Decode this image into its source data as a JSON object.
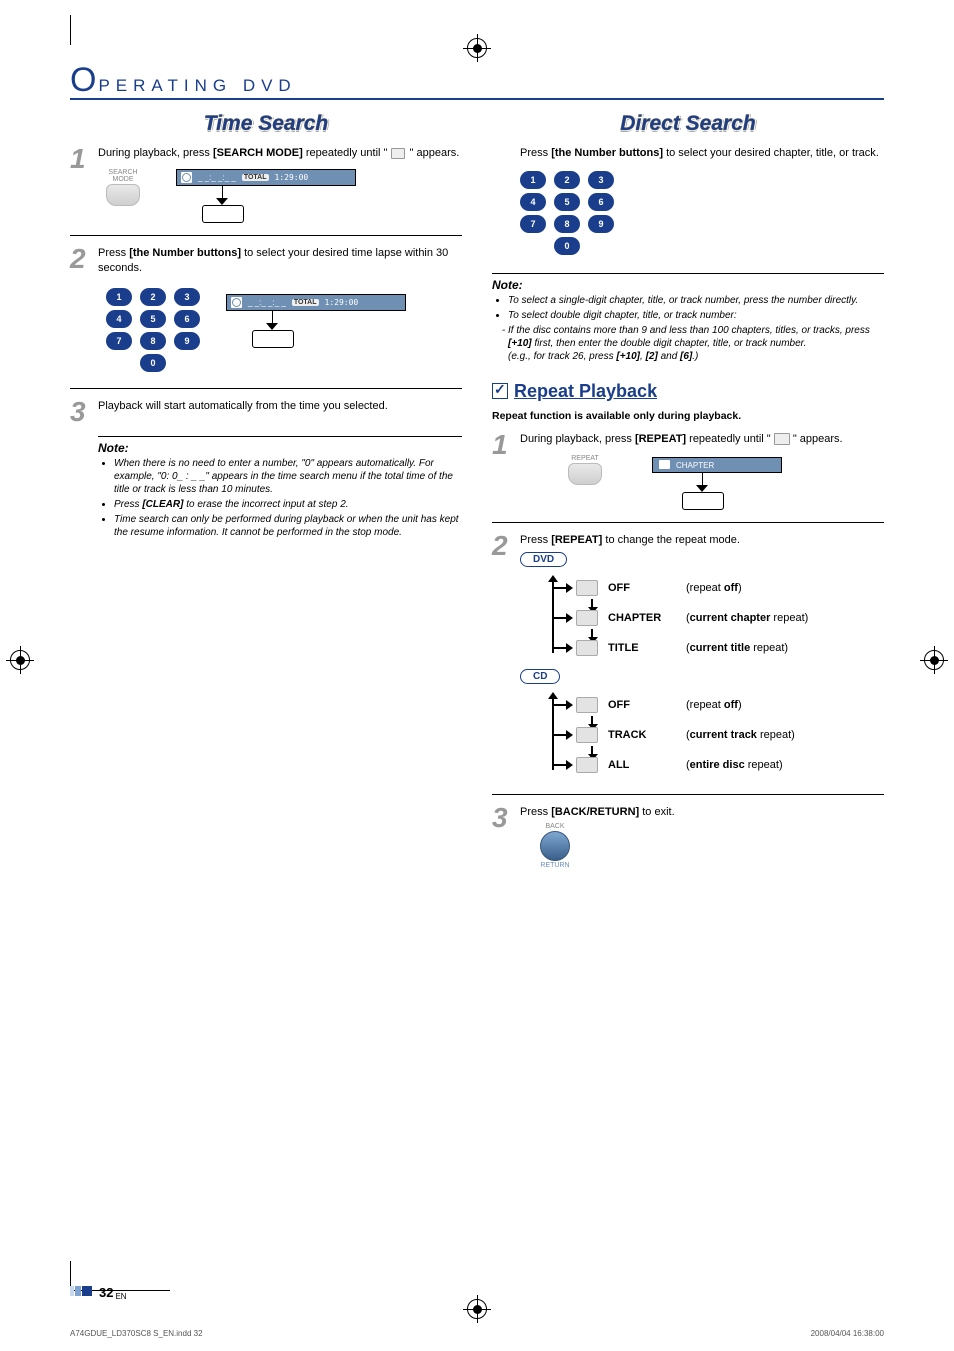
{
  "header": {
    "big_letter": "O",
    "rest": "PERATING   DVD"
  },
  "titles": {
    "time_search": "Time Search",
    "direct_search": "Direct Search",
    "repeat_playback": "Repeat Playback"
  },
  "time_search": {
    "step1": {
      "pre": "During playback, press ",
      "bold": "[SEARCH MODE]",
      "post": " repeatedly until \" ",
      "post2": " \" appears."
    },
    "step1_key_label": "SEARCH\nMODE",
    "osd1": {
      "dashed": "_ _:_ _:_ _",
      "total_label": "TOTAL",
      "time": "1:29:00"
    },
    "step2": {
      "pre": "Press ",
      "bold": "[the Number buttons]",
      "post": " to select your desired time lapse within 30 seconds."
    },
    "osd2": {
      "dashed": "_ _:_ _:_ _",
      "total_label": "TOTAL",
      "time": "1:29:00"
    },
    "step3": "Playback will start automatically from the time you selected.",
    "note": {
      "title": "Note:",
      "items": [
        "When there is no need to enter a number, \"0\" appears automatically. For example, \"0: 0_ : _ _\" appears in the time search menu if the total time of the title or track is less than 10 minutes.",
        "Press [CLEAR] to erase the incorrect input at step 2.",
        "Time search can only be performed during playback or when the unit has kept the resume information. It cannot be performed in the stop mode."
      ],
      "clear_bold": "[CLEAR]"
    }
  },
  "direct_search": {
    "intro": {
      "pre": "Press ",
      "bold": "[the Number buttons]",
      "post": " to select your desired chapter, title, or track."
    },
    "note": {
      "title": "Note:",
      "items": [
        "To select a single-digit chapter, title, or track number, press the number directly.",
        "To select double digit chapter, title, or track number:",
        "If the disc contains more than 9 and less than 100 chapters, titles, or tracks, press [+10] first, then enter the double digit chapter, title, or track number.",
        "(e.g., for track 26, press [+10], [2] and [6].)"
      ],
      "bolds": {
        "plus10": "[+10]",
        "two": "[2]",
        "six": "[6]"
      }
    }
  },
  "repeat": {
    "subhead": "Repeat function is available only during playback.",
    "step1": {
      "pre": "During playback, press ",
      "bold": "[REPEAT]",
      "post": " repeatedly until \" ",
      "post2": " \" appears."
    },
    "step1_key_label": "REPEAT",
    "osd_label": "CHAPTER",
    "step2": {
      "pre": "Press ",
      "bold": "[REPEAT]",
      "post": " to change the repeat mode."
    },
    "dvd_label": "DVD",
    "cd_label": "CD",
    "dvd_rows": [
      {
        "mode": "OFF",
        "desc_pre": "(repeat ",
        "desc_bold": "off",
        "desc_post": ")"
      },
      {
        "mode": "CHAPTER",
        "desc_pre": "(",
        "desc_bold": "current chapter",
        "desc_post": " repeat)"
      },
      {
        "mode": "TITLE",
        "desc_pre": "(",
        "desc_bold": "current title",
        "desc_post": " repeat)"
      }
    ],
    "cd_rows": [
      {
        "mode": "OFF",
        "desc_pre": "(repeat ",
        "desc_bold": "off",
        "desc_post": ")"
      },
      {
        "mode": "TRACK",
        "desc_pre": "(",
        "desc_bold": "current track",
        "desc_post": " repeat)"
      },
      {
        "mode": "ALL",
        "desc_pre": "(",
        "desc_bold": "entire disc",
        "desc_post": " repeat)"
      }
    ],
    "step3": {
      "pre": "Press ",
      "bold": "[BACK/RETURN]",
      "post": " to exit."
    },
    "step3_key_top": "BACK",
    "step3_key_bot": "RETURN"
  },
  "numbers": [
    "1",
    "2",
    "3",
    "4",
    "5",
    "6",
    "7",
    "8",
    "9",
    "0"
  ],
  "page": {
    "number": "32",
    "lang": "EN"
  },
  "footer": {
    "left": "A74GDUE_LD370SC8 S_EN.indd   32",
    "right": "2008/04/04   16:38:00"
  }
}
